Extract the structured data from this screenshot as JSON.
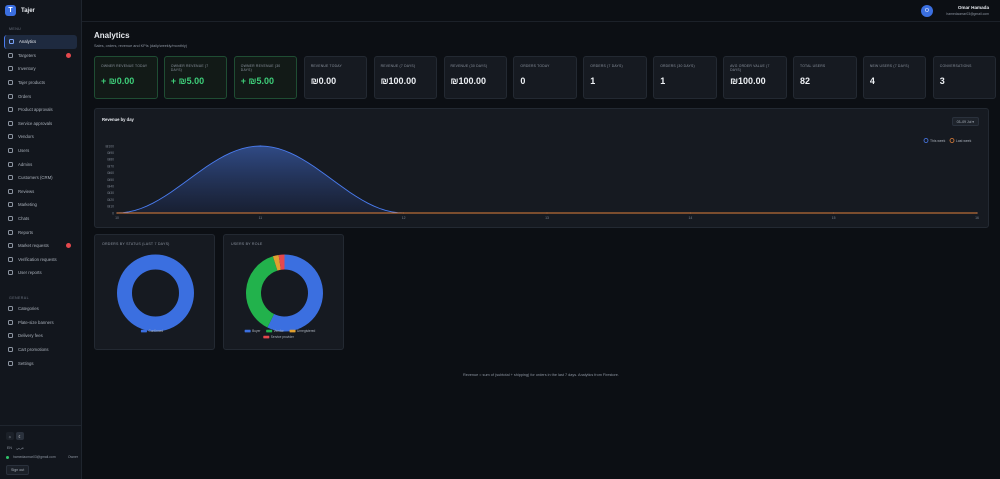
{
  "brand": {
    "name": "Tajer",
    "logo": "T"
  },
  "sidebar": {
    "section_main": "MENU",
    "items": [
      {
        "label": "Analytics",
        "icon": "chart-icon",
        "active": true,
        "badge": false
      },
      {
        "label": "Targeters",
        "icon": "target-icon",
        "active": false,
        "badge": true
      },
      {
        "label": "Inventory",
        "icon": "box-icon",
        "active": false,
        "badge": false
      },
      {
        "label": "Tajer products",
        "icon": "tag-icon",
        "active": false,
        "badge": false
      },
      {
        "label": "Orders",
        "icon": "cart-icon",
        "active": false,
        "badge": false
      },
      {
        "label": "Product approvals",
        "icon": "check-icon",
        "active": false,
        "badge": false
      },
      {
        "label": "Service approvals",
        "icon": "wrench-icon",
        "active": false,
        "badge": false
      },
      {
        "label": "Vendors",
        "icon": "store-icon",
        "active": false,
        "badge": false
      },
      {
        "label": "Users",
        "icon": "user-icon",
        "active": false,
        "badge": false
      },
      {
        "label": "Admins",
        "icon": "shield-icon",
        "active": false,
        "badge": false
      },
      {
        "label": "Customers (CRM)",
        "icon": "people-icon",
        "active": false,
        "badge": false
      },
      {
        "label": "Reviews",
        "icon": "star-icon",
        "active": false,
        "badge": false
      },
      {
        "label": "Marketing",
        "icon": "megaphone-icon",
        "active": false,
        "badge": false
      },
      {
        "label": "Chats",
        "icon": "chat-icon",
        "active": false,
        "badge": false
      },
      {
        "label": "Reports",
        "icon": "flag-icon",
        "active": false,
        "badge": false
      },
      {
        "label": "Market requests",
        "icon": "inbox-icon",
        "active": false,
        "badge": true
      },
      {
        "label": "Verification requests",
        "icon": "verify-icon",
        "active": false,
        "badge": false
      },
      {
        "label": "User reports",
        "icon": "alert-icon",
        "active": false,
        "badge": false
      }
    ],
    "section_general": "GENERAL",
    "general_items": [
      {
        "label": "Categories",
        "icon": "grid-icon"
      },
      {
        "label": "Plate-size banners",
        "icon": "image-icon"
      },
      {
        "label": "Delivery fees",
        "icon": "truck-icon"
      },
      {
        "label": "Cart promotions",
        "icon": "gift-icon"
      },
      {
        "label": "Settings",
        "icon": "gear-icon"
      }
    ],
    "theme_light": "☼",
    "theme_dark": "☾",
    "lang_en": "EN",
    "lang_ar": "عربي",
    "account_email": "hamedaomar03@gmail.com",
    "account_role": "Owner",
    "sign_out": "Sign out"
  },
  "header": {
    "avatar_initial": "O",
    "user_name": "Omar Hamada",
    "user_email": "hamedaomar03@gmail.com"
  },
  "page": {
    "title": "Analytics",
    "subtitle": "Sales, orders, revenue and KPIs (daily/weekly/monthly)"
  },
  "kpis": [
    {
      "label": "OWNER REVENUE TODAY",
      "value": "+ ₪0.00",
      "green": true
    },
    {
      "label": "OWNER REVENUE (7 DAYS)",
      "value": "+ ₪5.00",
      "green": true
    },
    {
      "label": "OWNER REVENUE (30 DAYS)",
      "value": "+ ₪5.00",
      "green": true
    },
    {
      "label": "REVENUE TODAY",
      "value": "₪0.00",
      "green": false
    },
    {
      "label": "REVENUE (7 DAYS)",
      "value": "₪100.00",
      "green": false
    },
    {
      "label": "REVENUE (30 DAYS)",
      "value": "₪100.00",
      "green": false
    },
    {
      "label": "ORDERS TODAY",
      "value": "0",
      "green": false
    },
    {
      "label": "ORDERS (7 DAYS)",
      "value": "1",
      "green": false
    },
    {
      "label": "ORDERS (30 DAYS)",
      "value": "1",
      "green": false
    },
    {
      "label": "AVG ORDER VALUE (7 DAYS)",
      "value": "₪100.00",
      "green": false
    },
    {
      "label": "TOTAL USERS",
      "value": "82",
      "green": false
    },
    {
      "label": "NEW USERS (7 DAYS)",
      "value": "4",
      "green": false
    },
    {
      "label": "CONVERSATIONS",
      "value": "3",
      "green": false
    }
  ],
  "revenue_panel": {
    "title": "Revenue by day",
    "period": "03–09 Jul ▾"
  },
  "chart_data": [
    {
      "type": "area",
      "title": "Revenue by day",
      "x": [
        "10",
        "11",
        "12",
        "13",
        "14",
        "15",
        "16"
      ],
      "y_ticks": [
        "0",
        "₪10",
        "₪20",
        "₪30",
        "₪40",
        "₪50",
        "₪60",
        "₪70",
        "₪80",
        "₪90",
        "₪100"
      ],
      "ylim": [
        0,
        100
      ],
      "legend_position": "top-right",
      "series": [
        {
          "name": "This week",
          "color": "#4a7cf0",
          "values": [
            0,
            100,
            0,
            0,
            0,
            0,
            0
          ]
        },
        {
          "name": "Last week",
          "color": "#e0803a",
          "values": [
            0,
            0,
            0,
            0,
            0,
            0,
            0
          ]
        }
      ]
    },
    {
      "type": "pie",
      "title": "ORDERS BY STATUS (LAST 7 DAYS)",
      "slices": [
        {
          "label": "Confirmed",
          "value": 1,
          "color": "#3b6fe0"
        }
      ]
    },
    {
      "type": "pie",
      "title": "USERS BY ROLE",
      "slices": [
        {
          "label": "Buyer",
          "value": 47,
          "color": "#3b6fe0"
        },
        {
          "label": "Vendor",
          "value": 31,
          "color": "#22b24c"
        },
        {
          "label": "Unregistered",
          "value": 2,
          "color": "#e0a030"
        },
        {
          "label": "Service provider",
          "value": 2,
          "color": "#e5484d"
        }
      ]
    }
  ],
  "footer_note": "Revenue = sum of (subtotal + shipping) for orders in the last 7 days. Analytics from Firestore."
}
